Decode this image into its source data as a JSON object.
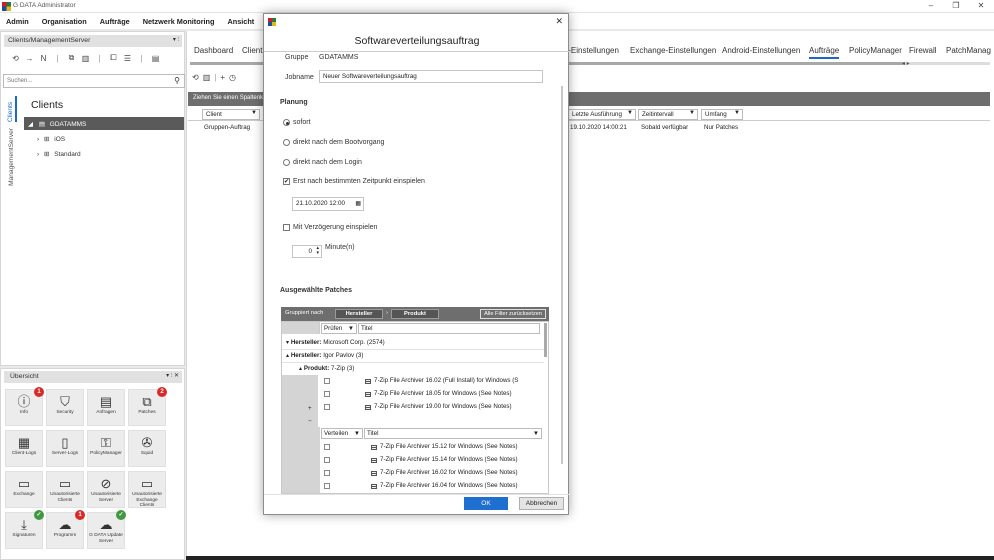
{
  "window": {
    "title": "G DATA Administrator",
    "minimize": "–",
    "maximize": "❐",
    "close": "✕"
  },
  "menu": [
    "Admin",
    "Organisation",
    "Aufträge",
    "Netzwerk Monitoring",
    "Ansicht"
  ],
  "left_panel": {
    "header": "Clients/ManagementServer",
    "header_controls": "▾ ⫶",
    "search_placeholder": "Suchen...",
    "vtabs": [
      "Clients",
      "ManagementServer"
    ],
    "title": "Clients",
    "tree": {
      "root": "GDATAMMS",
      "children": [
        "iOS",
        "Standard"
      ]
    }
  },
  "overview": {
    "header": "Übersicht",
    "header_controls": "▾ ⫶ ✕",
    "tiles": [
      {
        "label": "Info",
        "icon": "ⓘ",
        "badge": "1",
        "badge_color": "red"
      },
      {
        "label": "Security",
        "icon": "⛉",
        "badge": "",
        "badge_color": ""
      },
      {
        "label": "Anfragen",
        "icon": "▤",
        "badge": "",
        "badge_color": ""
      },
      {
        "label": "Patches",
        "icon": "⧉",
        "badge": "2",
        "badge_color": "red"
      },
      {
        "label": "Client-Logs",
        "icon": "▦",
        "badge": "",
        "badge_color": ""
      },
      {
        "label": "Server-Logs",
        "icon": "▯",
        "badge": "",
        "badge_color": ""
      },
      {
        "label": "PolicyManager",
        "icon": "⚿",
        "badge": "",
        "badge_color": ""
      },
      {
        "label": "Squid",
        "icon": "✇",
        "badge": "",
        "badge_color": ""
      },
      {
        "label": "Exchange",
        "icon": "▭",
        "badge": "",
        "badge_color": ""
      },
      {
        "label": "Unautorisierte Clients",
        "icon": "▭",
        "badge": "",
        "badge_color": ""
      },
      {
        "label": "Unautorisierte Server",
        "icon": "⊘",
        "badge": "",
        "badge_color": ""
      },
      {
        "label": "Unautorisierte Exchange Clients",
        "icon": "▭",
        "badge": "",
        "badge_color": ""
      },
      {
        "label": "Signaturen",
        "icon": "⤓",
        "badge": "✓",
        "badge_color": "green"
      },
      {
        "label": "Programm",
        "icon": "☁",
        "badge": "1",
        "badge_color": "red"
      },
      {
        "label": "G DATA Update Server",
        "icon": "☁",
        "badge": "✓",
        "badge_color": "green"
      }
    ]
  },
  "tabs": [
    {
      "label": "Dashboard"
    },
    {
      "label": "Clients"
    },
    {
      "label": "t-Einstellungen"
    },
    {
      "label": "Exchange-Einstellungen"
    },
    {
      "label": "Android-Einstellungen"
    },
    {
      "label": "Aufträge",
      "active": true
    },
    {
      "label": "PolicyManager"
    },
    {
      "label": "Firewall"
    },
    {
      "label": "PatchManag"
    }
  ],
  "main": {
    "group_hint": "Ziehen Sie einen Spaltenk",
    "columns_left": [
      "Client"
    ],
    "columns_right": [
      "Letzte Ausführung",
      "Zeitintervall",
      "Umfang"
    ],
    "row": {
      "client": "Gruppen-Auftrag",
      "last_run": "19.10.2020 14:00:21",
      "interval": "Sobald verfügbar",
      "scope": "Nur Patches"
    }
  },
  "dialog": {
    "title": "Softwareverteilungsauftrag",
    "group_label": "Gruppe",
    "group_value": "GDATAMMS",
    "jobname_label": "Jobname",
    "jobname_value": "Neuer Softwareverteilungsauftrag",
    "planning_heading": "Planung",
    "options": [
      {
        "label": "sofort",
        "selected": true
      },
      {
        "label": "direkt nach dem Bootvorgang",
        "selected": false
      },
      {
        "label": "direkt nach dem Login",
        "selected": false
      }
    ],
    "scheduled_label": "Erst nach bestimmten Zeitpunkt einspielen",
    "scheduled_checked": true,
    "datetime_value": "21.10.2020 12:00",
    "delay_label": "Mit Verzögerung einspielen",
    "delay_value": "0",
    "delay_unit": "Minute(n)",
    "patches_heading": "Ausgewählte Patches",
    "grouped_by": "Gruppiert nach",
    "group_chip_1": "Hersteller",
    "group_chip_2": "Produkt",
    "reset_filters": "Alle Filter zurücksetzen",
    "col_check": "Prüfen",
    "col_title": "Titel",
    "col_distribute": "Verteilen",
    "vendor_prefix": "Hersteller:",
    "vendor_1": "Microsoft Corp. (2574)",
    "vendor_2": "Igor Pavlov (3)",
    "product_prefix": "Produkt:",
    "product_1": "7-Zip (3)",
    "check_patches": [
      "7-Zip File Archiver 16.02 (Full Install) for Windows (S",
      "7-Zip File Archiver 18.05 for Windows (See Notes)",
      "7-Zip File Archiver 19.00 for Windows (See Notes)"
    ],
    "distribute_patches": [
      "7-Zip File Archiver 15.12 for Windows (See Notes)",
      "7-Zip File Archiver 15.14 for Windows (See Notes)",
      "7-Zip File Archiver 16.02 for Windows (See Notes)",
      "7-Zip File Archiver 16.04 for Windows (See Notes)",
      "7-Zip File Archiver 18.01 for Windows (See Notes)"
    ],
    "ok": "OK",
    "cancel": "Abbrechen"
  }
}
